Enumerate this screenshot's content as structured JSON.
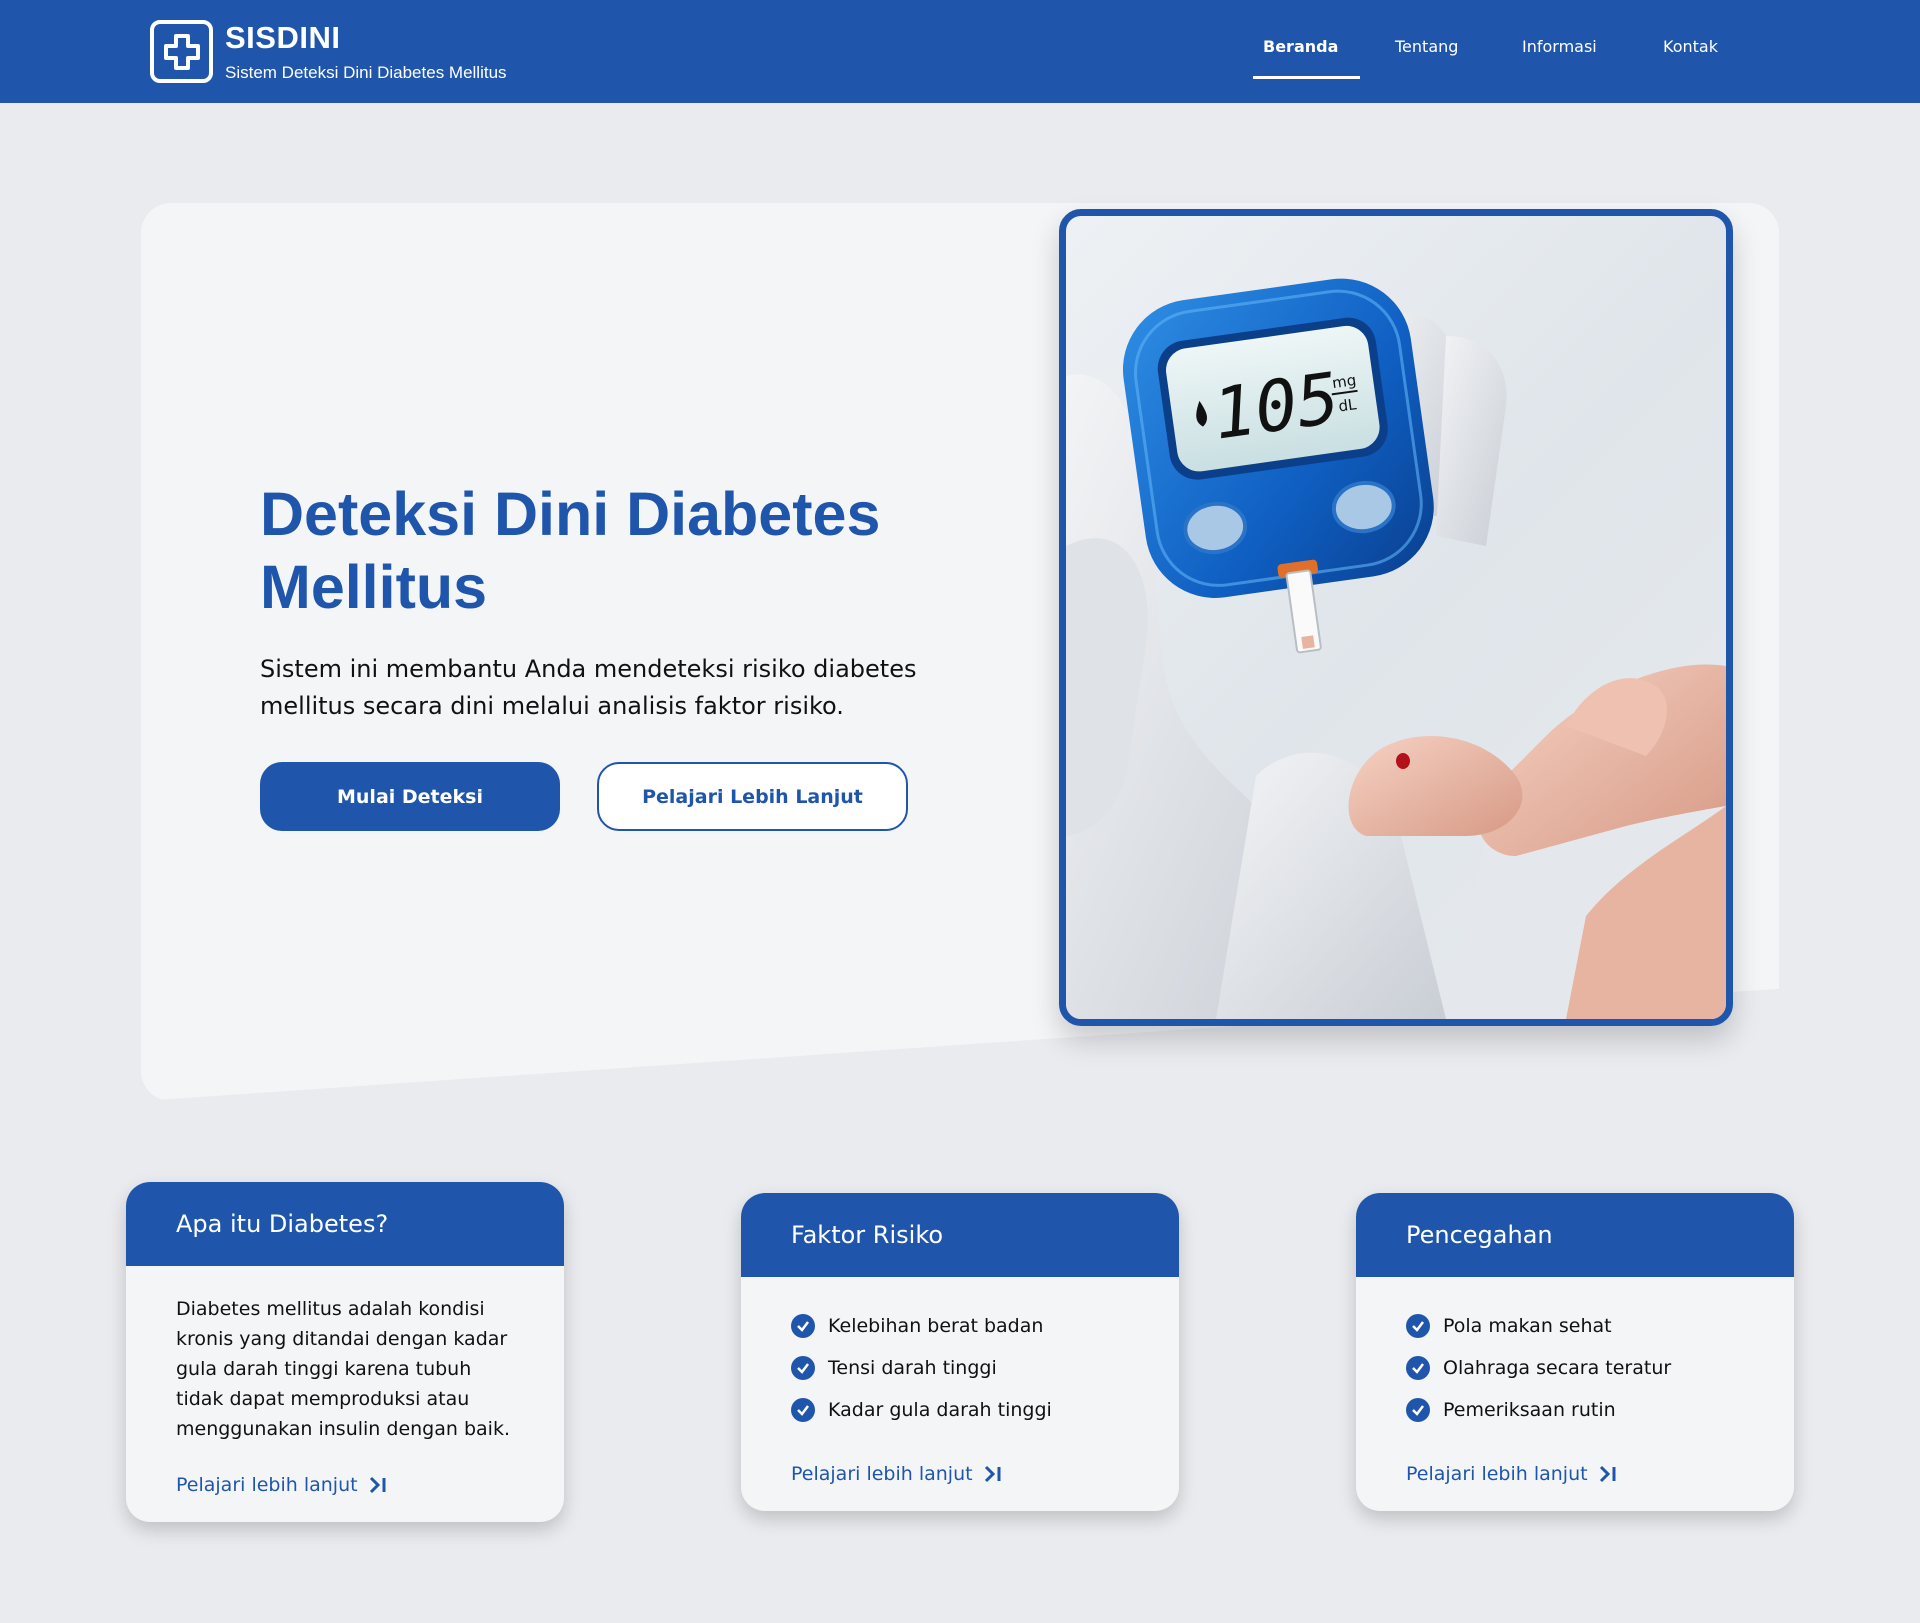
{
  "header": {
    "brand_name": "SISDINI",
    "brand_subtitle": "Sistem Deteksi Dini Diabetes Mellitus",
    "logo_icon": "medical-cross-icon",
    "nav": [
      {
        "label": "Beranda",
        "active": true
      },
      {
        "label": "Tentang",
        "active": false
      },
      {
        "label": "Informasi",
        "active": false
      },
      {
        "label": "Kontak",
        "active": false
      }
    ]
  },
  "hero": {
    "title": "Deteksi Dini Diabetes Mellitus",
    "description": "Sistem ini membantu Anda mendeteksi risiko diabetes mellitus secara dini melalui analisis faktor risiko.",
    "primary_button": "Mulai Deteksi",
    "secondary_button": "Pelajari Lebih Lanjut",
    "image": {
      "meter_reading": "105",
      "meter_unit_top": "mg",
      "meter_unit_bottom": "dL"
    }
  },
  "cards": [
    {
      "title": "Apa itu Diabetes?",
      "text": "Diabetes mellitus adalah kondisi kronis yang ditandai dengan kadar gula darah tinggi karena tubuh tidak dapat memproduksi atau menggunakan insulin dengan baik.",
      "link": "Pelajari lebih lanjut"
    },
    {
      "title": "Faktor Risiko",
      "items": [
        "Kelebihan berat badan",
        "Tensi darah tinggi",
        "Kadar gula darah tinggi"
      ],
      "link": "Pelajari lebih lanjut"
    },
    {
      "title": "Pencegahan",
      "items": [
        "Pola makan sehat",
        "Olahraga secara teratur",
        "Pemeriksaan rutin"
      ],
      "link": "Pelajari lebih lanjut"
    }
  ],
  "colors": {
    "primary": "#1f56ac",
    "page_background": "#e9ebef",
    "panel_background": "#f4f5f7"
  }
}
